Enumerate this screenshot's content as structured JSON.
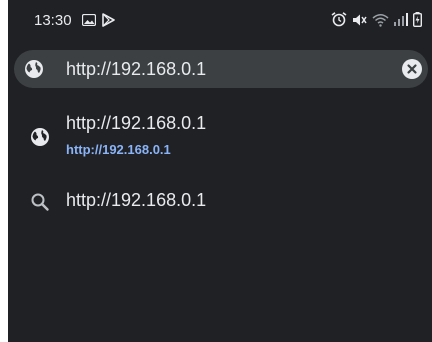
{
  "status_bar": {
    "time": "13:30",
    "left_icons": [
      "image-icon",
      "play-store-icon"
    ],
    "right_icons": [
      "alarm-icon",
      "mute-icon",
      "wifi-icon",
      "signal-icon",
      "battery-icon"
    ]
  },
  "omnibox": {
    "value": "http://192.168.0.1",
    "icon": "globe-icon",
    "clear_icon": "clear-icon"
  },
  "suggestions": [
    {
      "icon": "globe-icon",
      "title": "http://192.168.0.1",
      "url": "http://192.168.0.1"
    },
    {
      "icon": "search-icon",
      "title": "http://192.168.0.1"
    }
  ],
  "colors": {
    "background": "#202124",
    "omnibox": "#3c4043",
    "text": "#e8eaed",
    "link": "#8ab4f8"
  }
}
